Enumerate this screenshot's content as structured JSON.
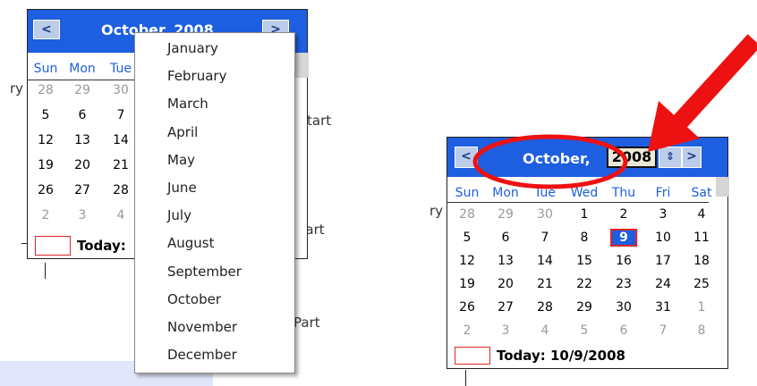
{
  "left_calendar": {
    "title": "October, 2008",
    "prev_label": "<",
    "next_label": ">",
    "days_of_week": [
      "Sun",
      "Mon",
      "Tue"
    ],
    "rows": [
      [
        "28",
        "29",
        "30"
      ],
      [
        "5",
        "6",
        "7"
      ],
      [
        "12",
        "13",
        "14"
      ],
      [
        "19",
        "20",
        "21"
      ],
      [
        "26",
        "27",
        "28"
      ],
      [
        "2",
        "3",
        "4"
      ]
    ],
    "today_label": "Today:"
  },
  "month_menu": {
    "items": [
      "January",
      "February",
      "March",
      "April",
      "May",
      "June",
      "July",
      "August",
      "September",
      "October",
      "November",
      "December"
    ]
  },
  "right_calendar": {
    "month_label": "October,",
    "year_value": "2008",
    "prev_label": "<",
    "next_label": ">",
    "spin_label": "⇕",
    "days_of_week": [
      "Sun",
      "Mon",
      "Tue",
      "Wed",
      "Thu",
      "Fri",
      "Sat"
    ],
    "rows": [
      [
        "28",
        "29",
        "30",
        "1",
        "2",
        "3",
        "4"
      ],
      [
        "5",
        "6",
        "7",
        "8",
        "9",
        "10",
        "11"
      ],
      [
        "12",
        "13",
        "14",
        "15",
        "16",
        "17",
        "18"
      ],
      [
        "19",
        "20",
        "21",
        "22",
        "23",
        "24",
        "25"
      ],
      [
        "26",
        "27",
        "28",
        "29",
        "30",
        "31",
        "1"
      ],
      [
        "2",
        "3",
        "4",
        "5",
        "6",
        "7",
        "8"
      ]
    ],
    "selected_day": "9",
    "today_label": "Today: 10/9/2008"
  },
  "background_fragments": {
    "ry_left": "ry",
    "art_top": "tart",
    "part_mid": "Part",
    "part_bottom": "Part",
    "ry_right": "ry"
  },
  "colors": {
    "header_blue": "#1e5ee0",
    "annotation_red": "#ee1111",
    "selected_border": "#e02424"
  }
}
